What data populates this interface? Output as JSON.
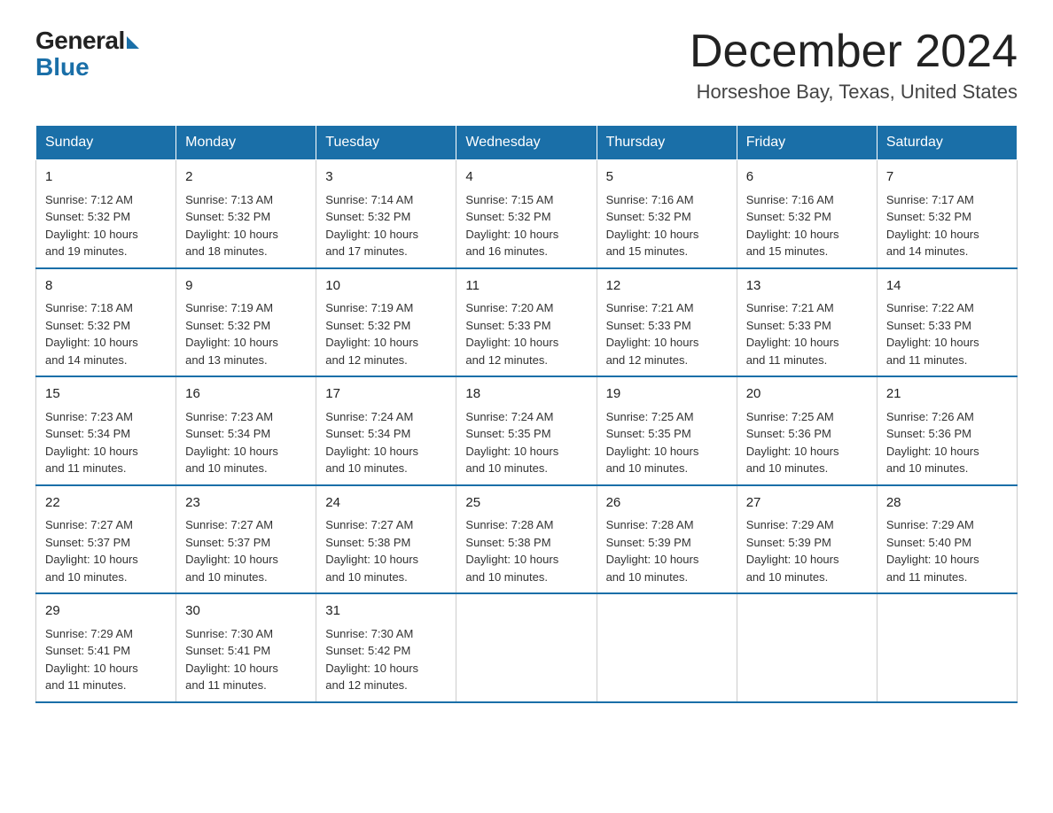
{
  "header": {
    "logo_general": "General",
    "logo_blue": "Blue",
    "month_title": "December 2024",
    "location": "Horseshoe Bay, Texas, United States"
  },
  "days_of_week": [
    "Sunday",
    "Monday",
    "Tuesday",
    "Wednesday",
    "Thursday",
    "Friday",
    "Saturday"
  ],
  "weeks": [
    [
      {
        "day": "1",
        "sunrise": "7:12 AM",
        "sunset": "5:32 PM",
        "daylight": "10 hours and 19 minutes."
      },
      {
        "day": "2",
        "sunrise": "7:13 AM",
        "sunset": "5:32 PM",
        "daylight": "10 hours and 18 minutes."
      },
      {
        "day": "3",
        "sunrise": "7:14 AM",
        "sunset": "5:32 PM",
        "daylight": "10 hours and 17 minutes."
      },
      {
        "day": "4",
        "sunrise": "7:15 AM",
        "sunset": "5:32 PM",
        "daylight": "10 hours and 16 minutes."
      },
      {
        "day": "5",
        "sunrise": "7:16 AM",
        "sunset": "5:32 PM",
        "daylight": "10 hours and 15 minutes."
      },
      {
        "day": "6",
        "sunrise": "7:16 AM",
        "sunset": "5:32 PM",
        "daylight": "10 hours and 15 minutes."
      },
      {
        "day": "7",
        "sunrise": "7:17 AM",
        "sunset": "5:32 PM",
        "daylight": "10 hours and 14 minutes."
      }
    ],
    [
      {
        "day": "8",
        "sunrise": "7:18 AM",
        "sunset": "5:32 PM",
        "daylight": "10 hours and 14 minutes."
      },
      {
        "day": "9",
        "sunrise": "7:19 AM",
        "sunset": "5:32 PM",
        "daylight": "10 hours and 13 minutes."
      },
      {
        "day": "10",
        "sunrise": "7:19 AM",
        "sunset": "5:32 PM",
        "daylight": "10 hours and 12 minutes."
      },
      {
        "day": "11",
        "sunrise": "7:20 AM",
        "sunset": "5:33 PM",
        "daylight": "10 hours and 12 minutes."
      },
      {
        "day": "12",
        "sunrise": "7:21 AM",
        "sunset": "5:33 PM",
        "daylight": "10 hours and 12 minutes."
      },
      {
        "day": "13",
        "sunrise": "7:21 AM",
        "sunset": "5:33 PM",
        "daylight": "10 hours and 11 minutes."
      },
      {
        "day": "14",
        "sunrise": "7:22 AM",
        "sunset": "5:33 PM",
        "daylight": "10 hours and 11 minutes."
      }
    ],
    [
      {
        "day": "15",
        "sunrise": "7:23 AM",
        "sunset": "5:34 PM",
        "daylight": "10 hours and 11 minutes."
      },
      {
        "day": "16",
        "sunrise": "7:23 AM",
        "sunset": "5:34 PM",
        "daylight": "10 hours and 10 minutes."
      },
      {
        "day": "17",
        "sunrise": "7:24 AM",
        "sunset": "5:34 PM",
        "daylight": "10 hours and 10 minutes."
      },
      {
        "day": "18",
        "sunrise": "7:24 AM",
        "sunset": "5:35 PM",
        "daylight": "10 hours and 10 minutes."
      },
      {
        "day": "19",
        "sunrise": "7:25 AM",
        "sunset": "5:35 PM",
        "daylight": "10 hours and 10 minutes."
      },
      {
        "day": "20",
        "sunrise": "7:25 AM",
        "sunset": "5:36 PM",
        "daylight": "10 hours and 10 minutes."
      },
      {
        "day": "21",
        "sunrise": "7:26 AM",
        "sunset": "5:36 PM",
        "daylight": "10 hours and 10 minutes."
      }
    ],
    [
      {
        "day": "22",
        "sunrise": "7:27 AM",
        "sunset": "5:37 PM",
        "daylight": "10 hours and 10 minutes."
      },
      {
        "day": "23",
        "sunrise": "7:27 AM",
        "sunset": "5:37 PM",
        "daylight": "10 hours and 10 minutes."
      },
      {
        "day": "24",
        "sunrise": "7:27 AM",
        "sunset": "5:38 PM",
        "daylight": "10 hours and 10 minutes."
      },
      {
        "day": "25",
        "sunrise": "7:28 AM",
        "sunset": "5:38 PM",
        "daylight": "10 hours and 10 minutes."
      },
      {
        "day": "26",
        "sunrise": "7:28 AM",
        "sunset": "5:39 PM",
        "daylight": "10 hours and 10 minutes."
      },
      {
        "day": "27",
        "sunrise": "7:29 AM",
        "sunset": "5:39 PM",
        "daylight": "10 hours and 10 minutes."
      },
      {
        "day": "28",
        "sunrise": "7:29 AM",
        "sunset": "5:40 PM",
        "daylight": "10 hours and 11 minutes."
      }
    ],
    [
      {
        "day": "29",
        "sunrise": "7:29 AM",
        "sunset": "5:41 PM",
        "daylight": "10 hours and 11 minutes."
      },
      {
        "day": "30",
        "sunrise": "7:30 AM",
        "sunset": "5:41 PM",
        "daylight": "10 hours and 11 minutes."
      },
      {
        "day": "31",
        "sunrise": "7:30 AM",
        "sunset": "5:42 PM",
        "daylight": "10 hours and 12 minutes."
      },
      null,
      null,
      null,
      null
    ]
  ]
}
